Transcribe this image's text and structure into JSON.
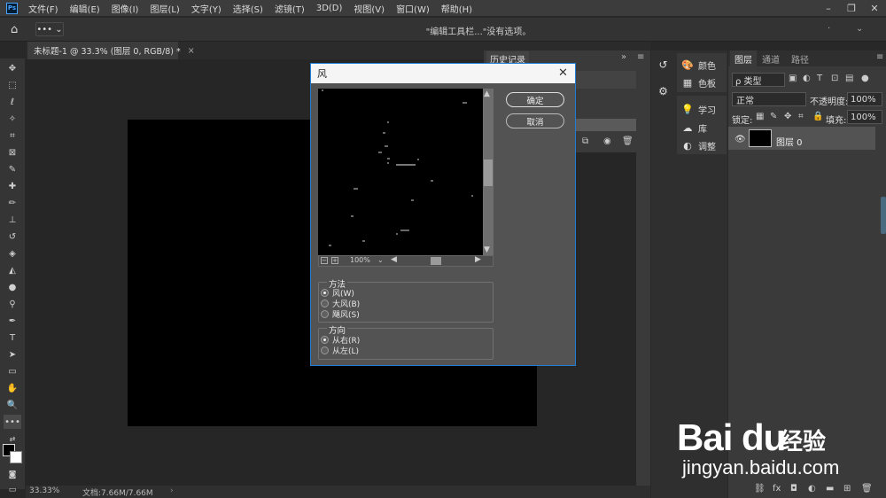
{
  "app": {
    "logo_text": "Ps"
  },
  "menubar": {
    "items": [
      "文件(F)",
      "编辑(E)",
      "图像(I)",
      "图层(L)",
      "文字(Y)",
      "选择(S)",
      "滤镜(T)",
      "3D(D)",
      "视图(V)",
      "窗口(W)",
      "帮助(H)"
    ]
  },
  "window_controls": {
    "minimize": "–",
    "restore": "❐",
    "close": "✕"
  },
  "options_bar": {
    "hint": "\"编辑工具栏...\"没有选项。",
    "more": "••• ⌄"
  },
  "document": {
    "tab_title": "未标题-1 @ 33.3% (图层 0, RGB/8) *",
    "close": "×"
  },
  "status": {
    "zoom": "33.33%",
    "doc": "文档:7.66M/7.66M",
    "arrow": "›"
  },
  "history_panel": {
    "tab": "历史记录",
    "collapse": "»",
    "menu": "≡"
  },
  "dock": {
    "group1": [
      {
        "icon": "color-icon",
        "label": "颜色",
        "glyph": "🎨"
      },
      {
        "icon": "swatches-icon",
        "label": "色板",
        "glyph": "▦"
      }
    ],
    "group2": [
      {
        "icon": "learn-icon",
        "label": "学习",
        "glyph": "💡"
      },
      {
        "icon": "libraries-icon",
        "label": "库",
        "glyph": "☁"
      },
      {
        "icon": "adjustments-icon",
        "label": "调整",
        "glyph": "◐"
      }
    ]
  },
  "layers_panel": {
    "tabs": [
      "图层",
      "通道",
      "路径"
    ],
    "kind": "ρ 类型",
    "blend_mode": "正常",
    "opacity_label": "不透明度:",
    "opacity": "100%",
    "lock_label": "锁定:",
    "fill_label": "填充:",
    "fill": "100%",
    "layer_name": "图层 0"
  },
  "wind_dialog": {
    "title": "风",
    "close": "✕",
    "ok": "确定",
    "cancel": "取消",
    "zoom": "100%",
    "zoom_dd": "⌄",
    "method_title": "方法",
    "method_options": [
      "风(W)",
      "大风(B)",
      "飓风(S)"
    ],
    "method_selected": 0,
    "direction_title": "方向",
    "direction_options": [
      "从右(R)",
      "从左(L)"
    ],
    "direction_selected": 0
  },
  "watermark": {
    "brand": "Bai du",
    "cn": "经验",
    "url": "jingyan.baidu.com"
  }
}
